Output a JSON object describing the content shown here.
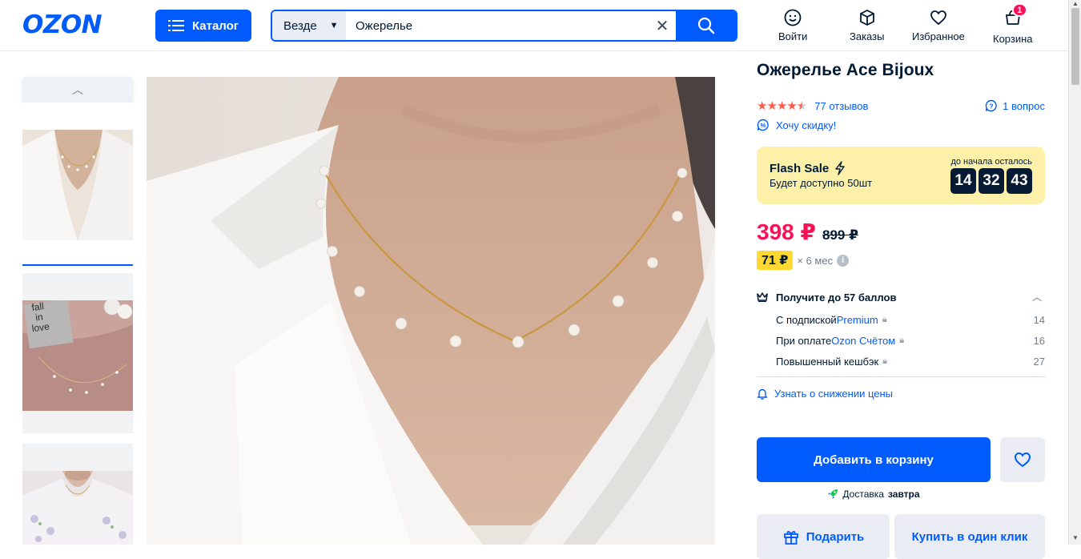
{
  "header": {
    "logo": "OZON",
    "catalog_label": "Каталог",
    "search": {
      "scope": "Везде",
      "query": "Ожерелье"
    },
    "nav": [
      {
        "label": "Войти"
      },
      {
        "label": "Заказы"
      },
      {
        "label": "Избранное"
      },
      {
        "label": "Корзина",
        "badge": "1"
      }
    ]
  },
  "gallery": {
    "thumbnails": [
      {
        "alt": "necklace-on-neck"
      },
      {
        "text_lines": [
          "fall",
          "in",
          "love"
        ]
      },
      {
        "alt": "necklace-floral-blouse"
      }
    ],
    "active_index": 0
  },
  "product": {
    "title": "Ожерелье Ace Bijoux",
    "rating": 4.5,
    "reviews": "77 отзывов",
    "questions": "1 вопрос",
    "discount_link": "Хочу скидку!",
    "flash_sale": {
      "title": "Flash Sale",
      "subtitle": "Будет доступно 50шт",
      "countdown_caption": "до начала осталось",
      "hours": "14",
      "minutes": "32",
      "seconds": "43"
    },
    "price": "398 ₽",
    "old_price": "899 ₽",
    "installment_amount": "71 ₽",
    "installment_period": "× 6 мес",
    "bonus": {
      "title": "Получите до 57 баллов",
      "items": [
        {
          "prefix": "С подпиской ",
          "link": "Premium",
          "value": "14"
        },
        {
          "prefix": "При оплате ",
          "link": "Ozon Счётом",
          "value": "16"
        },
        {
          "prefix": "Повышенный кешбэк",
          "link": "",
          "value": "27"
        }
      ]
    },
    "price_notify": "Узнать о снижении цены",
    "add_to_cart": "Добавить в корзину",
    "delivery_prefix": "Доставка",
    "delivery_day": "завтра",
    "gift": "Подарить",
    "one_click": "Купить в один клик"
  },
  "colors": {
    "brand": "#005bff",
    "price": "#f91155",
    "flash_bg": "#fdf1a9",
    "stars": "#ff5c49"
  }
}
